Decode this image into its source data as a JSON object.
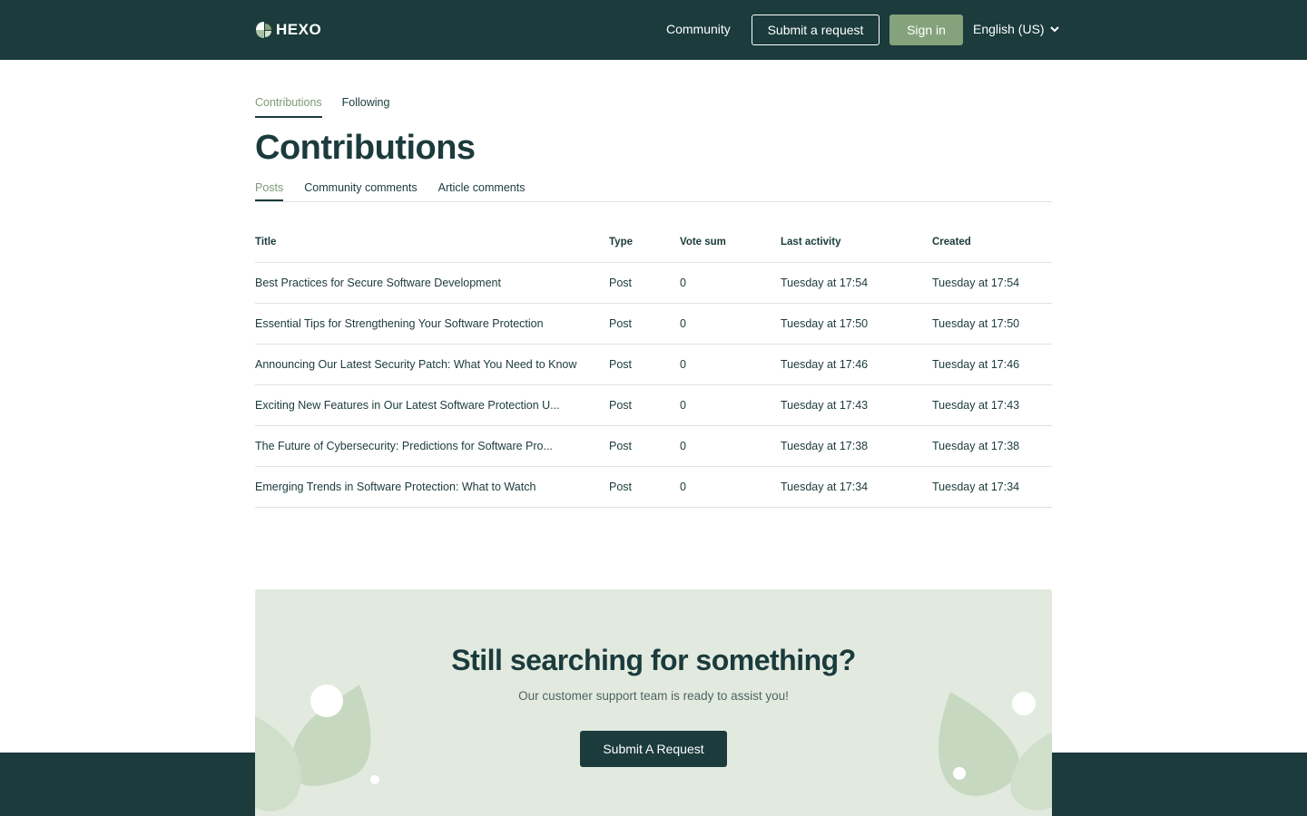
{
  "header": {
    "logo_text": "HEXO",
    "nav_community": "Community",
    "submit_request": "Submit a request",
    "sign_in": "Sign in",
    "language": "English (US)"
  },
  "top_tabs": [
    {
      "label": "Contributions",
      "active": true
    },
    {
      "label": "Following",
      "active": false
    }
  ],
  "page_title": "Contributions",
  "sub_tabs": [
    {
      "label": "Posts",
      "active": true
    },
    {
      "label": "Community comments",
      "active": false
    },
    {
      "label": "Article comments",
      "active": false
    }
  ],
  "table": {
    "headers": [
      "Title",
      "Type",
      "Vote sum",
      "Last activity",
      "Created"
    ],
    "rows": [
      {
        "title": "Best Practices for Secure Software Development",
        "type": "Post",
        "votes": "0",
        "last_activity": "Tuesday at 17:54",
        "created": "Tuesday at 17:54"
      },
      {
        "title": "Essential Tips for Strengthening Your Software Protection",
        "type": "Post",
        "votes": "0",
        "last_activity": "Tuesday at 17:50",
        "created": "Tuesday at 17:50"
      },
      {
        "title": "Announcing Our Latest Security Patch: What You Need to Know",
        "type": "Post",
        "votes": "0",
        "last_activity": "Tuesday at 17:46",
        "created": "Tuesday at 17:46"
      },
      {
        "title": "Exciting New Features in Our Latest Software Protection U...",
        "type": "Post",
        "votes": "0",
        "last_activity": "Tuesday at 17:43",
        "created": "Tuesday at 17:43"
      },
      {
        "title": "The Future of Cybersecurity: Predictions for Software Pro...",
        "type": "Post",
        "votes": "0",
        "last_activity": "Tuesday at 17:38",
        "created": "Tuesday at 17:38"
      },
      {
        "title": "Emerging Trends in Software Protection: What to Watch",
        "type": "Post",
        "votes": "0",
        "last_activity": "Tuesday at 17:34",
        "created": "Tuesday at 17:34"
      }
    ]
  },
  "cta": {
    "title": "Still searching for something?",
    "subtitle": "Our customer support team is ready to assist you!",
    "button": "Submit A Request"
  },
  "colors": {
    "brand_dark": "#1b3b3c",
    "accent_green": "#84a37c",
    "cta_background": "#e2eadf"
  }
}
